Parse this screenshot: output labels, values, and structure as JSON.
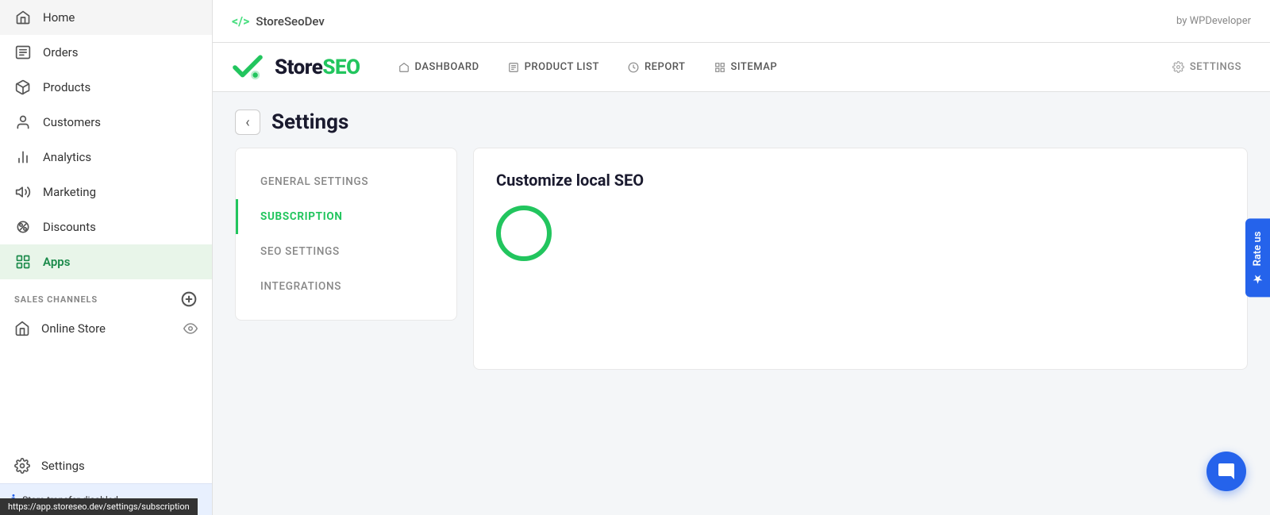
{
  "sidebar": {
    "items": [
      {
        "id": "home",
        "label": "Home",
        "icon": "home"
      },
      {
        "id": "orders",
        "label": "Orders",
        "icon": "orders"
      },
      {
        "id": "products",
        "label": "Products",
        "icon": "products"
      },
      {
        "id": "customers",
        "label": "Customers",
        "icon": "customers"
      },
      {
        "id": "analytics",
        "label": "Analytics",
        "icon": "analytics"
      },
      {
        "id": "marketing",
        "label": "Marketing",
        "icon": "marketing"
      },
      {
        "id": "discounts",
        "label": "Discounts",
        "icon": "discounts"
      },
      {
        "id": "apps",
        "label": "Apps",
        "icon": "apps",
        "active": true
      }
    ],
    "sales_channels_label": "SALES CHANNELS",
    "online_store_label": "Online Store",
    "settings_label": "Settings",
    "store_transfer_label": "Store transfer disabled"
  },
  "topbar": {
    "code_icon": "</>",
    "brand_name": "StoreSeoDev",
    "by_label": "by WPDeveloper"
  },
  "storeseo": {
    "logo_text_part1": "Store",
    "logo_text_part2": "SEO",
    "nav": [
      {
        "id": "dashboard",
        "label": "DASHBOARD",
        "icon": "🏠"
      },
      {
        "id": "product-list",
        "label": "PRODUCT LIST",
        "icon": "☰"
      },
      {
        "id": "report",
        "label": "REPORT",
        "icon": "📊"
      },
      {
        "id": "sitemap",
        "label": "SITEMAP",
        "icon": "⊞"
      }
    ],
    "settings_label": "SETTINGS"
  },
  "settings_page": {
    "title": "Settings",
    "back_label": "‹",
    "sidebar_items": [
      {
        "id": "general",
        "label": "GENERAL SETTINGS",
        "active": false
      },
      {
        "id": "subscription",
        "label": "SUBSCRIPTION",
        "active": true
      },
      {
        "id": "seo",
        "label": "SEO SETTINGS",
        "active": false
      },
      {
        "id": "integrations",
        "label": "INTEGRATIONS",
        "active": false
      }
    ],
    "panel_title": "Customize local SEO"
  },
  "rate_us": {
    "label": "Rate us",
    "star": "★"
  },
  "chat": {
    "icon": "💬"
  },
  "url_bar": {
    "url": "https://app.storeseo.dev/settings/subscription"
  }
}
